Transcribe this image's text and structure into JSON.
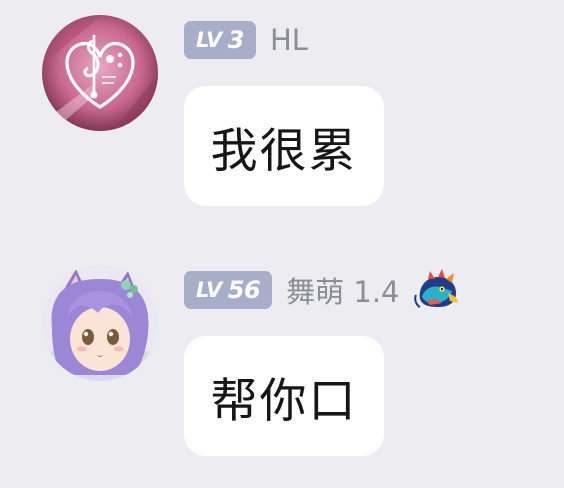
{
  "messages": [
    {
      "avatar_icon": "treble-bass-clef-heart-avatar",
      "level_prefix": "LV",
      "level_value": "3",
      "nickname": "HL",
      "text": "我很累"
    },
    {
      "avatar_icon": "anime-catgirl-avatar",
      "level_prefix": "LV",
      "level_value": "56",
      "nickname": "舞萌 1.4",
      "medal_icon": "dragon-head-icon",
      "text": "帮你口"
    }
  ],
  "colors": {
    "background": "#ececf1",
    "badge": "#a6aec9",
    "nickname": "#8c8e96",
    "bubble": "#ffffff",
    "text": "#161616"
  }
}
